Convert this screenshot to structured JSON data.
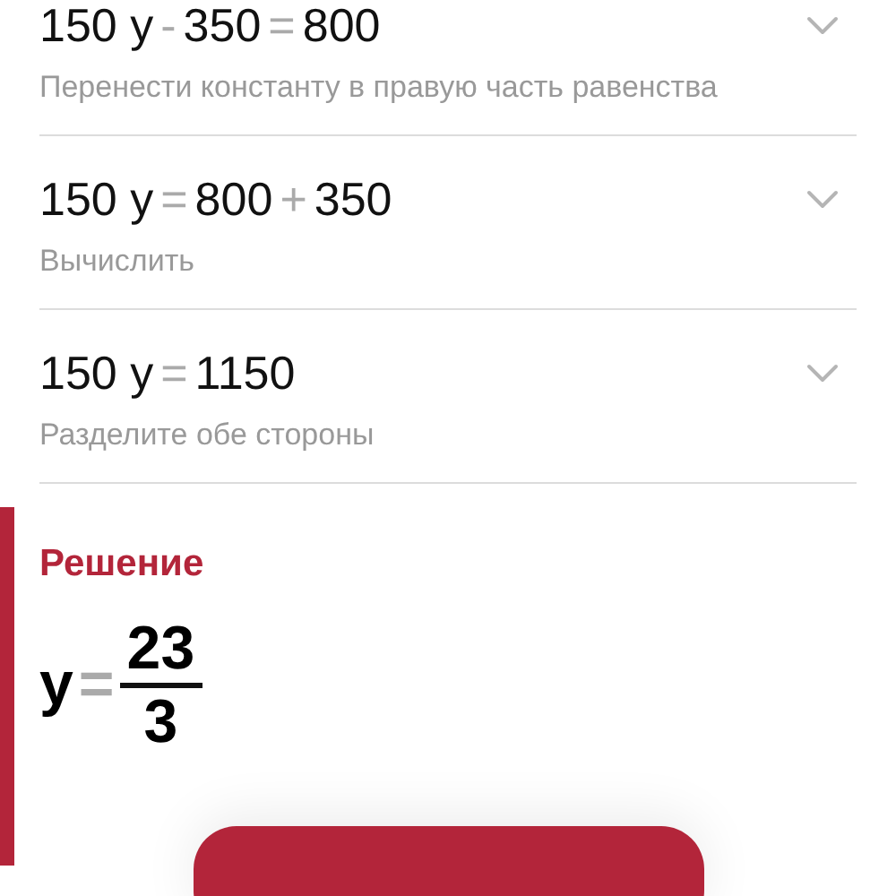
{
  "steps": [
    {
      "equation": [
        {
          "text": "150 y",
          "kind": "term"
        },
        {
          "text": "-",
          "kind": "op"
        },
        {
          "text": "350",
          "kind": "term"
        },
        {
          "text": "=",
          "kind": "op"
        },
        {
          "text": "800",
          "kind": "term"
        }
      ],
      "description": "Перенести константу в правую часть равенства",
      "expanded": false
    },
    {
      "equation": [
        {
          "text": "150 y",
          "kind": "term"
        },
        {
          "text": "=",
          "kind": "op"
        },
        {
          "text": "800",
          "kind": "term"
        },
        {
          "text": "+",
          "kind": "op"
        },
        {
          "text": "350",
          "kind": "term"
        }
      ],
      "description": "Вычислить",
      "expanded": false
    },
    {
      "equation": [
        {
          "text": "150 y",
          "kind": "term"
        },
        {
          "text": "=",
          "kind": "op"
        },
        {
          "text": "1150",
          "kind": "term"
        }
      ],
      "description": "Разделите обе стороны",
      "expanded": false
    }
  ],
  "solution": {
    "title": "Решение",
    "variable": "y",
    "equals": "=",
    "numerator": "23",
    "denominator": "3"
  }
}
